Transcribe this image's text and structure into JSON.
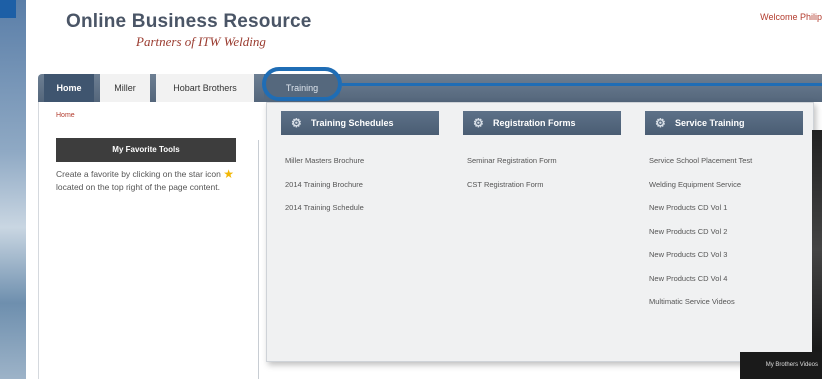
{
  "header": {
    "title": "Online Business Resource",
    "subtitle": "Partners of ITW Welding",
    "welcome": "Welcome Philip"
  },
  "nav": {
    "tabs": [
      {
        "label": "Home"
      },
      {
        "label": "Miller"
      },
      {
        "label": "Hobart Brothers"
      },
      {
        "label": "Training"
      }
    ]
  },
  "breadcrumb": "Home",
  "favorites": {
    "header": "My Favorite Tools",
    "text_before": "Create a favorite by clicking on the star icon",
    "text_after": "located on the top right of the page content."
  },
  "dropdown": {
    "columns": [
      {
        "header": "Training Schedules",
        "items": [
          "Miller Masters Brochure",
          "2014 Training Brochure",
          "2014 Training Schedule"
        ]
      },
      {
        "header": "Registration Forms",
        "items": [
          "Seminar Registration Form",
          "CST Registration Form"
        ]
      },
      {
        "header": "Service Training",
        "items": [
          "Service School Placement Test",
          "Welding Equipment Service",
          "New Products CD Vol 1",
          "New Products CD Vol 2",
          "New Products CD Vol 3",
          "New Products CD Vol 4",
          "Multimatic Service Videos"
        ]
      }
    ]
  },
  "colors": {
    "highlight": "#1f6db5",
    "nav_bg": "#54667b",
    "accent_red": "#b33c2e"
  },
  "icons": {
    "column_icon": "gear-icon",
    "favorite_icon": "star-icon"
  },
  "bottom_caption": "My Brothers Videos"
}
